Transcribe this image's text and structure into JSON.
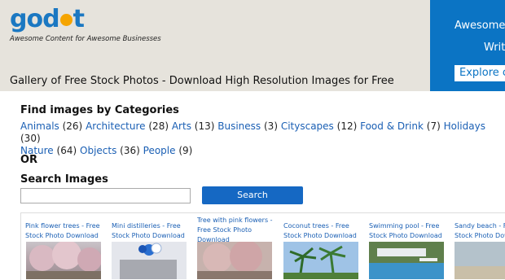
{
  "header": {
    "logo_pre": "god",
    "logo_post": "t",
    "tagline": "Awesome Content for Awesome Businesses",
    "page_title": "Gallery of Free Stock Photos - Download High Resolution Images for Free"
  },
  "ad": {
    "line1": "Awesome",
    "line2": "Writ",
    "button": "Explore c"
  },
  "categories": {
    "heading": "Find images by Categories",
    "items": [
      {
        "label": "Animals",
        "count": "(26)"
      },
      {
        "label": "Architecture",
        "count": "(28)"
      },
      {
        "label": "Arts",
        "count": "(13)"
      },
      {
        "label": "Business",
        "count": "(3)"
      },
      {
        "label": "Cityscapes",
        "count": "(12)"
      },
      {
        "label": "Food & Drink",
        "count": "(7)"
      },
      {
        "label": "Holidays",
        "count": "(30)"
      },
      {
        "label": "Nature",
        "count": "(64)"
      },
      {
        "label": "Objects",
        "count": "(36)"
      },
      {
        "label": "People",
        "count": "(9)"
      }
    ]
  },
  "or_label": "OR",
  "search": {
    "heading": "Search Images",
    "value": "",
    "button": "Search"
  },
  "gallery": [
    {
      "caption": "Pink flower trees - Free Stock Photo Download"
    },
    {
      "caption": "Mini distilleries - Free Stock Photo Download"
    },
    {
      "caption": "Tree with pink flowers - Free Stock Photo Download"
    },
    {
      "caption": "Coconut trees - Free Stock Photo Download"
    },
    {
      "caption": "Swimming pool - Free Stock Photo Download"
    },
    {
      "caption": "Sandy beach - Free Stock Photo Download"
    }
  ],
  "colors": {
    "accent": "#1b78c2",
    "link": "#1a5fb4",
    "sun": "#f5a400",
    "ad_bg": "#0b74c4",
    "header_bg": "#e6e3dc"
  }
}
